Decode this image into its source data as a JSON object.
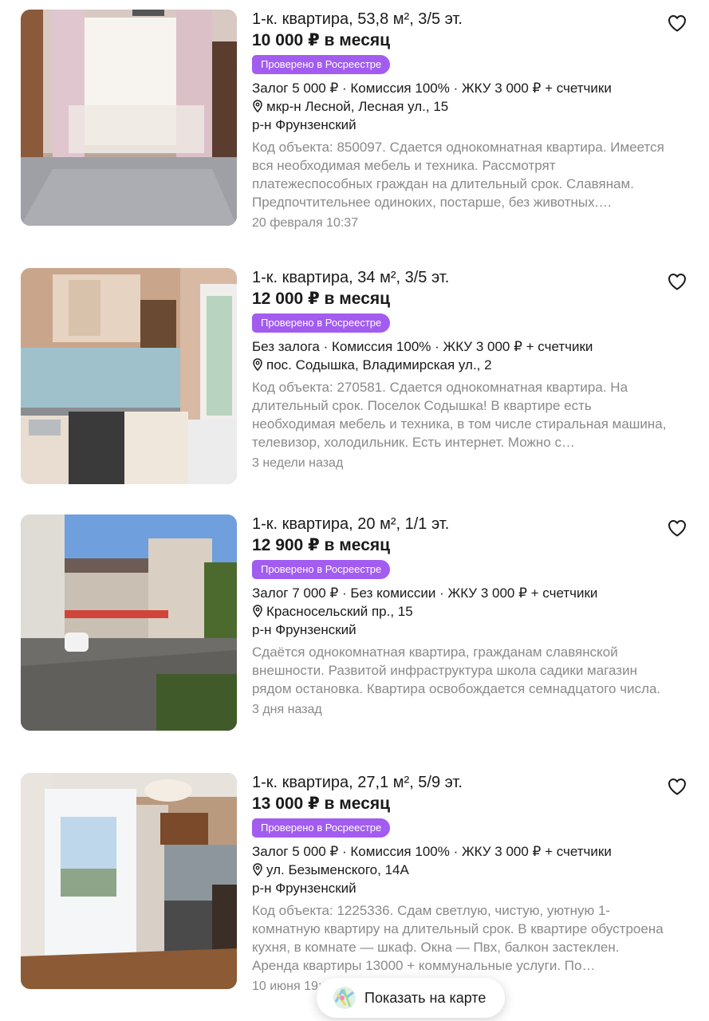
{
  "listings": [
    {
      "title": "1-к. квартира, 53,8 м², 3/5 эт.",
      "price": "10 000 ₽ в месяц",
      "badge": "Проверено в Росреестре",
      "terms": "Залог 5 000 ₽ · Комиссия 100% · ЖКУ 3 000 ₽ + счетчики",
      "address": "мкр-н Лесной, Лесная ул., 15",
      "district": "р-н Фрунзенский",
      "description": "Код объекта: 850097. Сдается однокомнатная квартира. Имеется вся необходимая мебель и техника. Рассмотрят платежеспособных граждан на длительный срок. Славянам. Предпочтительнее одиноких, постарше, без животных. Санузел…",
      "date": "20 февраля 10:37",
      "photo": "room-with-window-photo"
    },
    {
      "title": "1-к. квартира, 34 м², 3/5 эт.",
      "price": "12 000 ₽ в месяц",
      "badge": "Проверено в Росреестре",
      "terms": "Без залога · Комиссия 100% · ЖКУ 3 000 ₽ + счетчики",
      "address": "пос. Содышка, Владимирская ул., 2",
      "district": "",
      "description": "Код объекта: 270581. Сдается однокомнатная квартира. На длительный срок. Поселок Содышка! В квартире есть необходимая мебель и техника, в том числе стиральная машина, телевизор, холодильник. Есть интернет. Можно с…",
      "date": "3 недели назад",
      "photo": "kitchen-photo"
    },
    {
      "title": "1-к. квартира, 20 м², 1/1 эт.",
      "price": "12 900 ₽ в месяц",
      "badge": "Проверено в Росреестре",
      "terms": "Залог 7 000 ₽ · Без комиссии · ЖКУ 3 000 ₽ + счетчики",
      "address": "Красносельский пр., 15",
      "district": "р-н Фрунзенский",
      "description": "Сдаётся однокомнатная квартира, гражданам славянской внешности. Развитой инфраструктура школа садики магазин рядом остановка. Квартира освобождается семнадцатого числа.",
      "date": "3 дня назад",
      "photo": "building-exterior-photo"
    },
    {
      "title": "1-к. квартира, 27,1 м², 5/9 эт.",
      "price": "13 000 ₽ в месяц",
      "badge": "Проверено в Росреестре",
      "terms": "Залог 5 000 ₽ · Комиссия 100% · ЖКУ 3 000 ₽ + счетчики",
      "address": "ул. Безыменского, 14А",
      "district": "р-н Фрунзенский",
      "description": "Код объекта: 1225336. Сдам светлую, чистую, уютную 1-комнатную квартиру на длительный срок. В квартире обустроена кухня, в комнате — шкаф. Окна — Пвх, балкон застеклен. Аренда квартиры 13000 + коммунальные услуги. По…",
      "date": "10 июня 19:…",
      "photo": "kitchen-room-photo"
    }
  ],
  "map_button": {
    "label": "Показать на карте",
    "icon": "map-icon"
  },
  "colors": {
    "badge": "#a25cf0",
    "muted_text": "#8a8a8a",
    "text": "#1a1a1a"
  }
}
